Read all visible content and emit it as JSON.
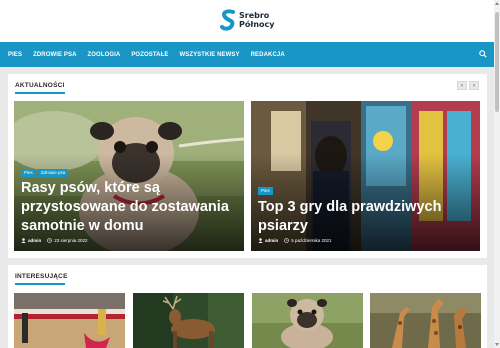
{
  "site": {
    "name_line1": "Srebro",
    "name_line2": "Północy"
  },
  "nav": {
    "items": [
      "PIES",
      "ZDROWIE PSA",
      "ZOOLOGIA",
      "POZOSTAŁE",
      "WSZYSTKIE NEWSY",
      "REDAKCJA"
    ]
  },
  "news": {
    "heading": "AKTUALNOŚCI",
    "prev_arrow": "‹",
    "next_arrow": "›",
    "cards": [
      {
        "tags": [
          "Pies",
          "Zdrowie psa"
        ],
        "title": "Rasy psów, które są przystosowane do zostawania samotnie w domu",
        "author": "admin",
        "date": "23 sierpnia 2022"
      },
      {
        "tags": [
          "Pies"
        ],
        "title": "Top 3 gry dla prawdziwych psiarzy",
        "author": "admin",
        "date": "5 października 2021"
      }
    ]
  },
  "interesting": {
    "heading": "INTERESUJĄCE"
  },
  "colors": {
    "accent": "#1996c6",
    "header_bg": "#ffffff",
    "page_bg": "#e9e9e9"
  },
  "icons": [
    "logo-icon",
    "search-icon",
    "chevron-left-icon",
    "chevron-right-icon",
    "user-icon",
    "clock-icon"
  ]
}
